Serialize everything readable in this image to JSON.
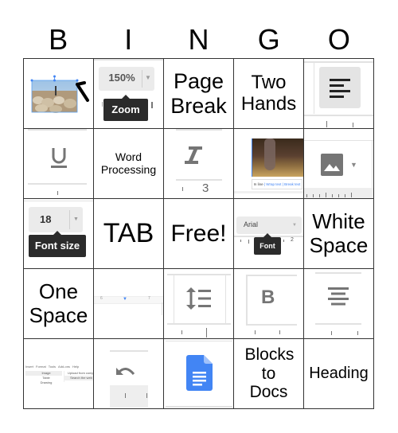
{
  "header": {
    "letters": [
      "B",
      "I",
      "N",
      "G",
      "O"
    ]
  },
  "cells": [
    {
      "id": "b1",
      "type": "image",
      "description": "selected image of sheep with cursor arrow",
      "icon": "image-resize-icon"
    },
    {
      "id": "i1",
      "type": "screenshot",
      "value": "150%",
      "tooltip": "Zoom",
      "icon": "zoom-dropdown"
    },
    {
      "id": "n1",
      "type": "text",
      "label": "Page Break"
    },
    {
      "id": "g1",
      "type": "text",
      "label": "Two Hands"
    },
    {
      "id": "o1",
      "type": "icon",
      "icon": "align-left-icon"
    },
    {
      "id": "b2",
      "type": "icon",
      "icon": "underline-icon"
    },
    {
      "id": "i2",
      "type": "text",
      "label": "Word Processing"
    },
    {
      "id": "n2",
      "type": "icon",
      "icon": "italic-icon",
      "ruler_number": "3"
    },
    {
      "id": "g2",
      "type": "image",
      "description": "image with wrap options",
      "options": [
        "In line",
        "Wrap text",
        "Break text"
      ]
    },
    {
      "id": "o2",
      "type": "icon",
      "icon": "insert-image-icon"
    },
    {
      "id": "b3",
      "type": "screenshot",
      "value": "18",
      "tooltip": "Font size"
    },
    {
      "id": "i3",
      "type": "text",
      "label": "TAB"
    },
    {
      "id": "n3",
      "type": "text",
      "label": "Free!"
    },
    {
      "id": "g3",
      "type": "screenshot",
      "value": "Arial",
      "tooltip": "Font",
      "ruler_number": "2"
    },
    {
      "id": "o3",
      "type": "text",
      "label": "White Space"
    },
    {
      "id": "b4",
      "type": "text",
      "label": "One Space"
    },
    {
      "id": "i4",
      "type": "screenshot",
      "description": "ruler with indent marker",
      "ruler_numbers": [
        "6",
        "7"
      ]
    },
    {
      "id": "n4",
      "type": "icon",
      "icon": "line-spacing-icon"
    },
    {
      "id": "g4",
      "type": "icon",
      "icon": "bold-icon"
    },
    {
      "id": "o4",
      "type": "icon",
      "icon": "align-center-icon"
    },
    {
      "id": "b5",
      "type": "screenshot",
      "description": "Insert menu",
      "menu": [
        "Insert",
        "Format",
        "Tools",
        "Add-ons",
        "Help"
      ],
      "items": [
        "Image",
        "Table",
        "Drawing"
      ],
      "submenu": [
        "Upload from computer",
        "Search the web"
      ]
    },
    {
      "id": "i5",
      "type": "icon",
      "icon": "undo-icon"
    },
    {
      "id": "n5",
      "type": "icon",
      "icon": "google-docs-icon"
    },
    {
      "id": "g5",
      "type": "text",
      "label": "Blocks to Docs"
    },
    {
      "id": "o5",
      "type": "text",
      "label": "Heading"
    }
  ],
  "colors": {
    "docs_blue": "#4285f4",
    "tooltip_bg": "#2b2b2b",
    "icon_gray": "#757575",
    "grid_line": "#333333"
  }
}
